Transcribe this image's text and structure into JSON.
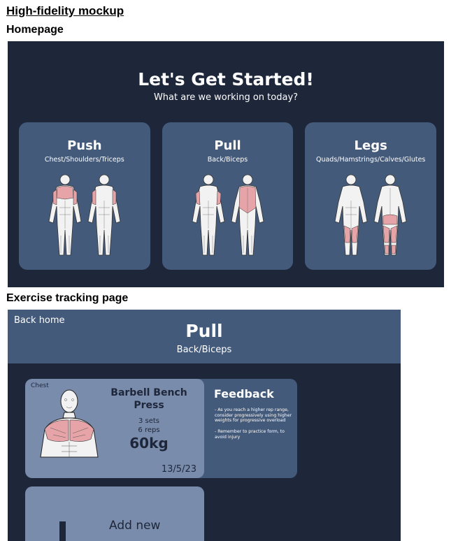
{
  "document": {
    "title": "High-fidelity mockup",
    "section_homepage": "Homepage",
    "section_tracking": "Exercise tracking page"
  },
  "homepage": {
    "heading": "Let's Get Started!",
    "subheading": "What are we working on today?",
    "cards": [
      {
        "title": "Push",
        "subtitle": "Chest/Shoulders/Triceps",
        "icon": "push-muscles-icon"
      },
      {
        "title": "Pull",
        "subtitle": "Back/Biceps",
        "icon": "pull-muscles-icon"
      },
      {
        "title": "Legs",
        "subtitle": "Quads/Hamstrings/Calves/Glutes",
        "icon": "legs-muscles-icon"
      }
    ]
  },
  "tracking": {
    "back_label": "Back home",
    "title": "Pull",
    "subtitle": "Back/Biceps",
    "exercise": {
      "tag": "Chest",
      "name": "Barbell Bench Press",
      "sets": "3 sets",
      "reps": "6 reps",
      "weight": "60kg",
      "date": "13/5/23",
      "icon": "chest-muscles-icon"
    },
    "feedback": {
      "title": "Feedback",
      "notes": [
        "- As you reach a higher rep range, consider progressively using higher weights for progressive overload",
        "- Remember to practice form, to avoid injury"
      ]
    },
    "add_new_label": "Add new"
  },
  "colors": {
    "page_bg": "#1e263a",
    "card_bg": "#445a7a",
    "exercise_card_bg": "#7a8cab",
    "highlight_muscle": "#e6a3a8"
  }
}
